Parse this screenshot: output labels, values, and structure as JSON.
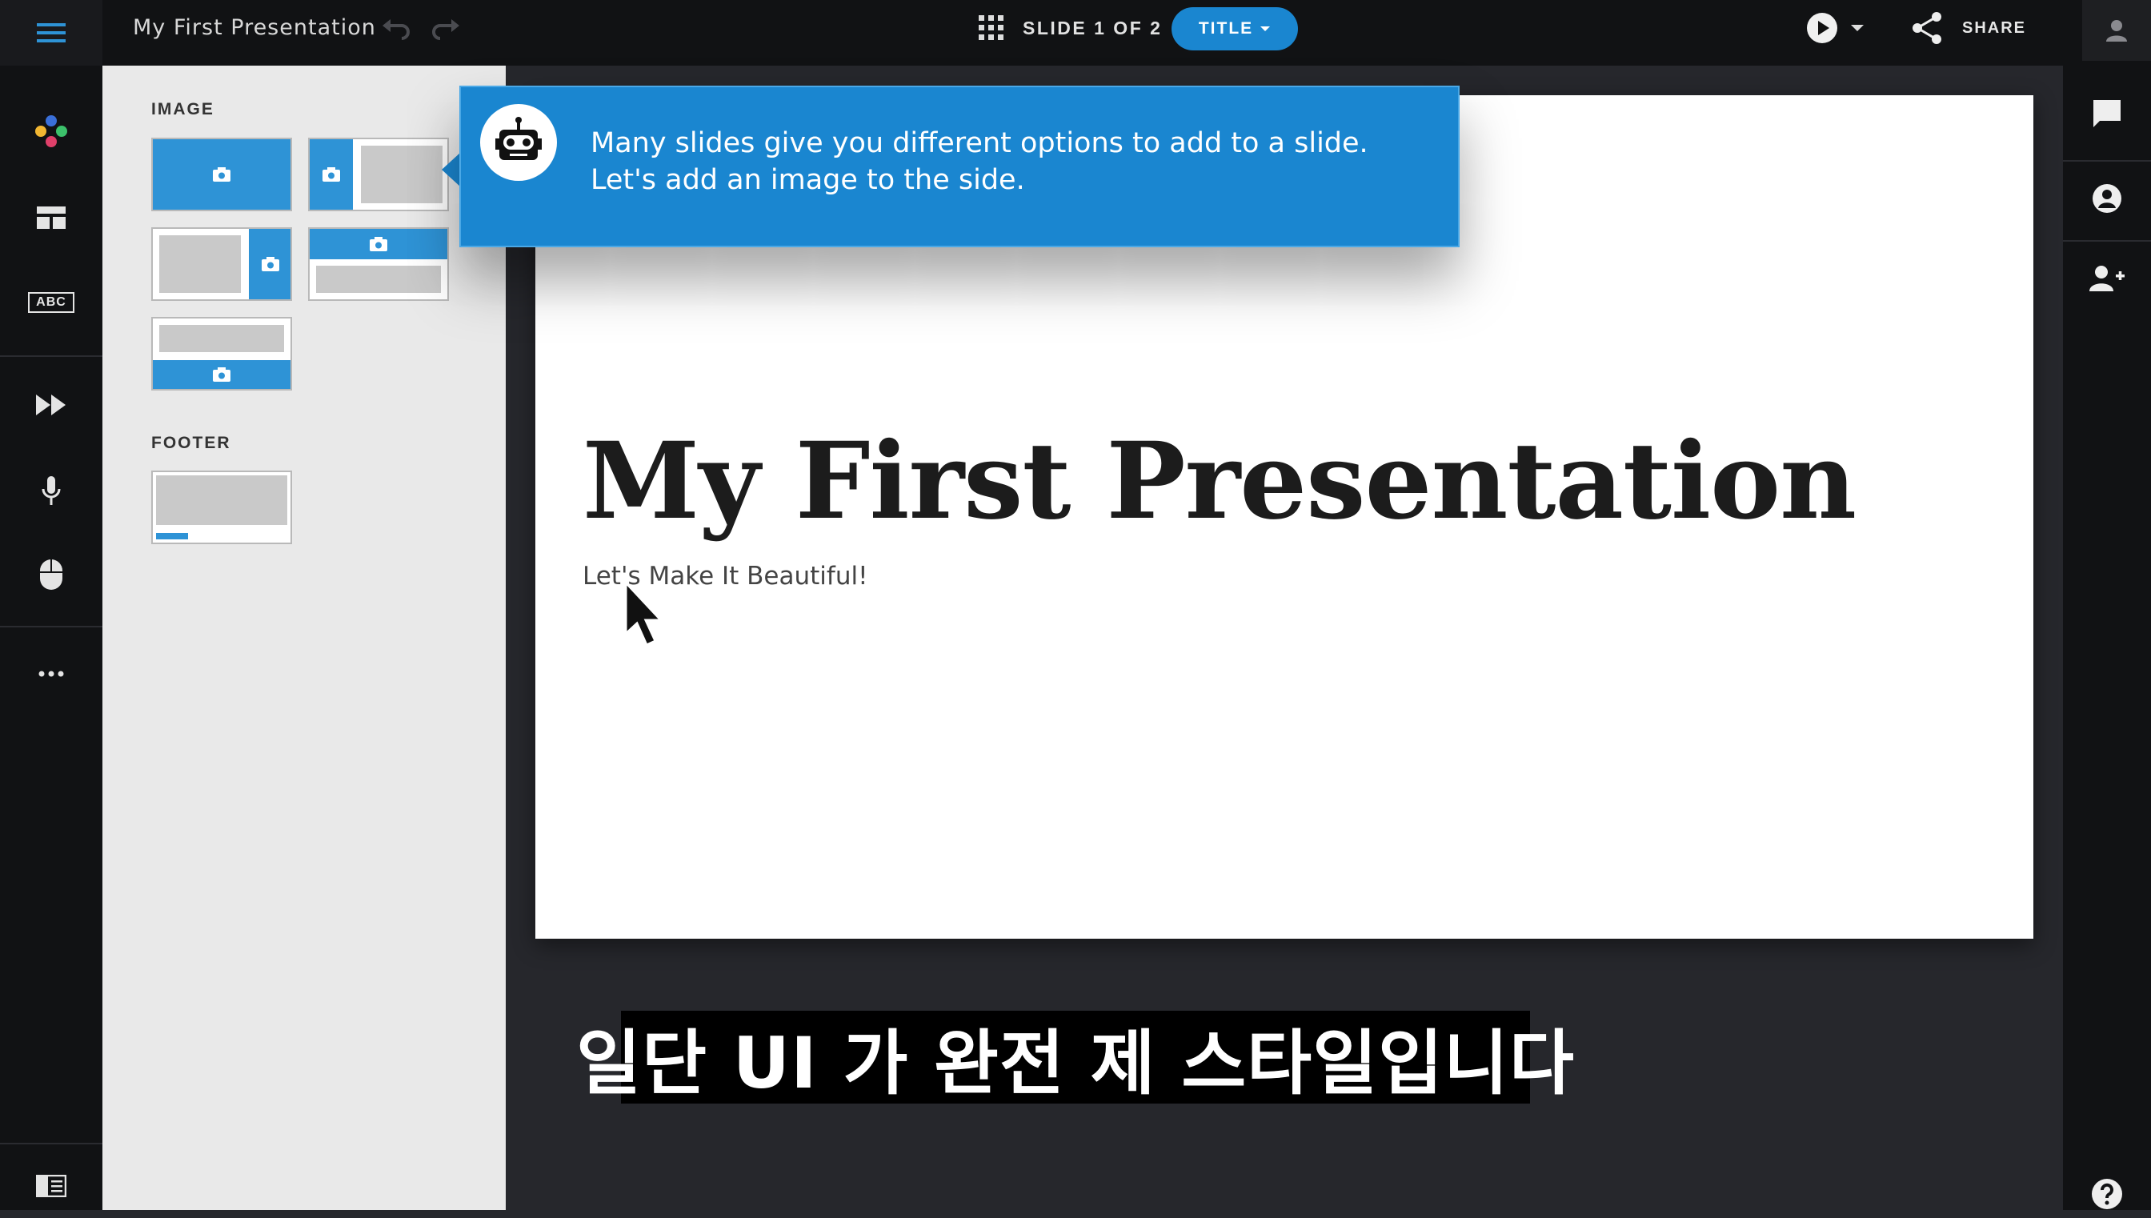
{
  "header": {
    "document_title": "My First Presentation",
    "slide_counter": "SLIDE 1 OF 2",
    "layout_button": "TITLE",
    "share_label": "SHARE"
  },
  "panel": {
    "image_section_label": "IMAGE",
    "footer_section_label": "FOOTER"
  },
  "left_rail": {
    "text_icon_label": "ABC"
  },
  "slide": {
    "title": "My First Presentation",
    "subtitle": "Let's Make It Beautiful!"
  },
  "tooltip": {
    "text": "Many slides give you different options to add to a slide. Let's add an image to the side."
  },
  "caption": {
    "text": "일단 UI 가 완전 제 스타일입니다"
  },
  "colors": {
    "accent": "#1a86d0",
    "dark_bg": "#111214",
    "panel_bg": "#e9e9e9",
    "canvas_bg": "#26272c"
  },
  "icons": [
    "hamburger-menu-icon",
    "undo-icon",
    "redo-icon",
    "grid-icon",
    "caret-down-icon",
    "play-icon",
    "share-icon",
    "user-icon",
    "logo-icon",
    "layout-icon",
    "text-icon",
    "fast-forward-icon",
    "microphone-icon",
    "mouse-icon",
    "more-icon",
    "panel-toggle-icon",
    "comment-icon",
    "account-icon",
    "add-user-icon",
    "help-icon",
    "camera-icon",
    "robot-icon",
    "cursor-icon"
  ]
}
